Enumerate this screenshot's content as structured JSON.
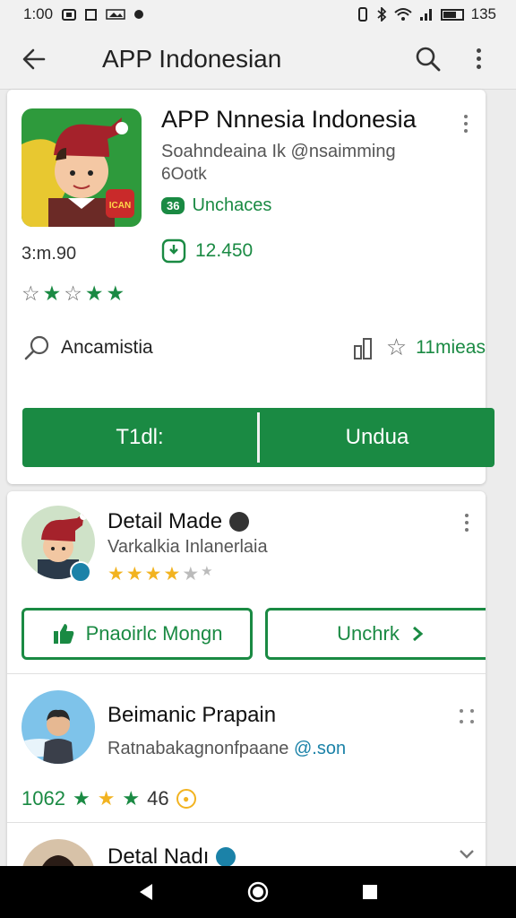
{
  "status_bar": {
    "time": "1:00",
    "battery": "135"
  },
  "app_bar": {
    "title": "APP Indonesian"
  },
  "app_card": {
    "name": "APP Nnnesia Indonesia",
    "developer": "Soahndeaina Ik @nsaimming",
    "developer_sub": "6Ootk",
    "badge": "36",
    "badge_text": "Unchaces",
    "size": "3:m.90",
    "downloads": "12.450",
    "category": "Ancamistia",
    "rank_text": "11mieas",
    "install_left": "T1dl:",
    "install_right": "Undua",
    "icon_sign_text": "ICAN",
    "colors": {
      "accent": "#1a8a43",
      "icon_background": "#2e9a3c",
      "icon_accent": "#e8c830"
    }
  },
  "list": [
    {
      "name": "Detail Made",
      "subtitle": "Varkalkia Inlanerlaia",
      "rating": 3.5,
      "primary_button": "Pnaoirlc Mongn",
      "secondary_button": "Unchrk"
    },
    {
      "name": "Beimanic Prapain",
      "subtitle": "Ratnabakagnonfpaane",
      "email": "@.son",
      "stat_count": "1062",
      "stat_value": "46"
    },
    {
      "name": "Detal Nadı"
    }
  ],
  "icons": {
    "back": "arrow-left-icon",
    "search": "search-icon",
    "more": "more-vert-icon",
    "download": "download-icon",
    "category": "magnifier-icon",
    "rank": "bar-chart-icon",
    "thumb": "thumbs-up-icon",
    "chevron": "chevron-right-icon"
  }
}
